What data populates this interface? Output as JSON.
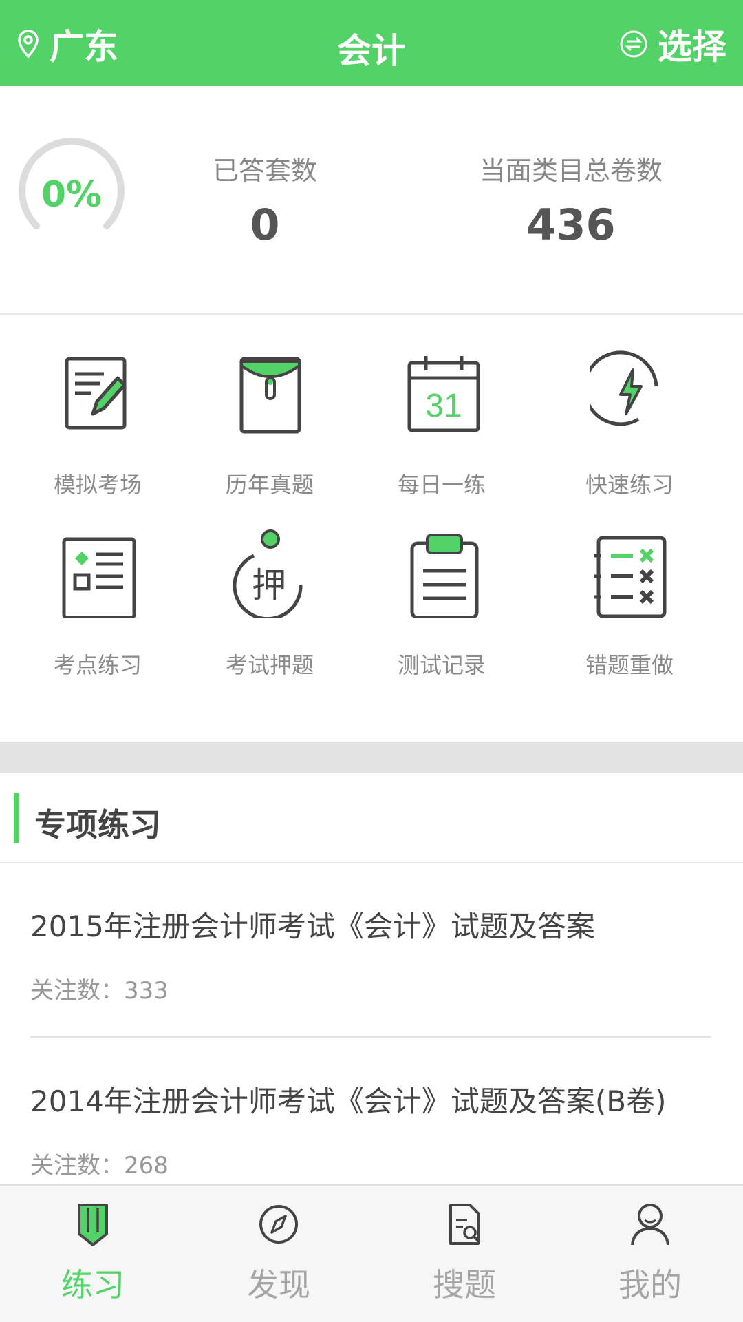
{
  "header": {
    "location": "广东",
    "title": "会计",
    "select_label": "选择"
  },
  "stats": {
    "progress_text": "0%",
    "progress_fraction": 0,
    "answered_label": "已答套数",
    "answered_value": "0",
    "total_label": "当面类目总卷数",
    "total_value": "436"
  },
  "grid": [
    {
      "label": "模拟考场",
      "icon": "exam-pencil-icon"
    },
    {
      "label": "历年真题",
      "icon": "envelope-folder-icon"
    },
    {
      "label": "每日一练",
      "icon": "calendar-icon",
      "calendar_day": "31"
    },
    {
      "label": "快速练习",
      "icon": "lightning-icon"
    },
    {
      "label": "考点练习",
      "icon": "checklist-icon"
    },
    {
      "label": "考试押题",
      "icon": "bet-question-icon",
      "glyph": "押"
    },
    {
      "label": "测试记录",
      "icon": "clipboard-icon"
    },
    {
      "label": "错题重做",
      "icon": "wrong-questions-icon"
    }
  ],
  "section": {
    "title": "专项练习",
    "items": [
      {
        "title": "2015年注册会计师考试《会计》试题及答案",
        "count_label": "关注数：",
        "count": "333"
      },
      {
        "title": "2014年注册会计师考试《会计》试题及答案(B卷)",
        "count_label": "关注数：",
        "count": "268"
      }
    ]
  },
  "nav": [
    {
      "label": "练习",
      "icon": "pencil-icon",
      "active": true
    },
    {
      "label": "发现",
      "icon": "compass-icon",
      "active": false
    },
    {
      "label": "搜题",
      "icon": "search-document-icon",
      "active": false
    },
    {
      "label": "我的",
      "icon": "user-icon",
      "active": false
    }
  ],
  "colors": {
    "accent": "#52d267",
    "text_gray": "#8a8a8a",
    "dark_gray": "#444444"
  }
}
